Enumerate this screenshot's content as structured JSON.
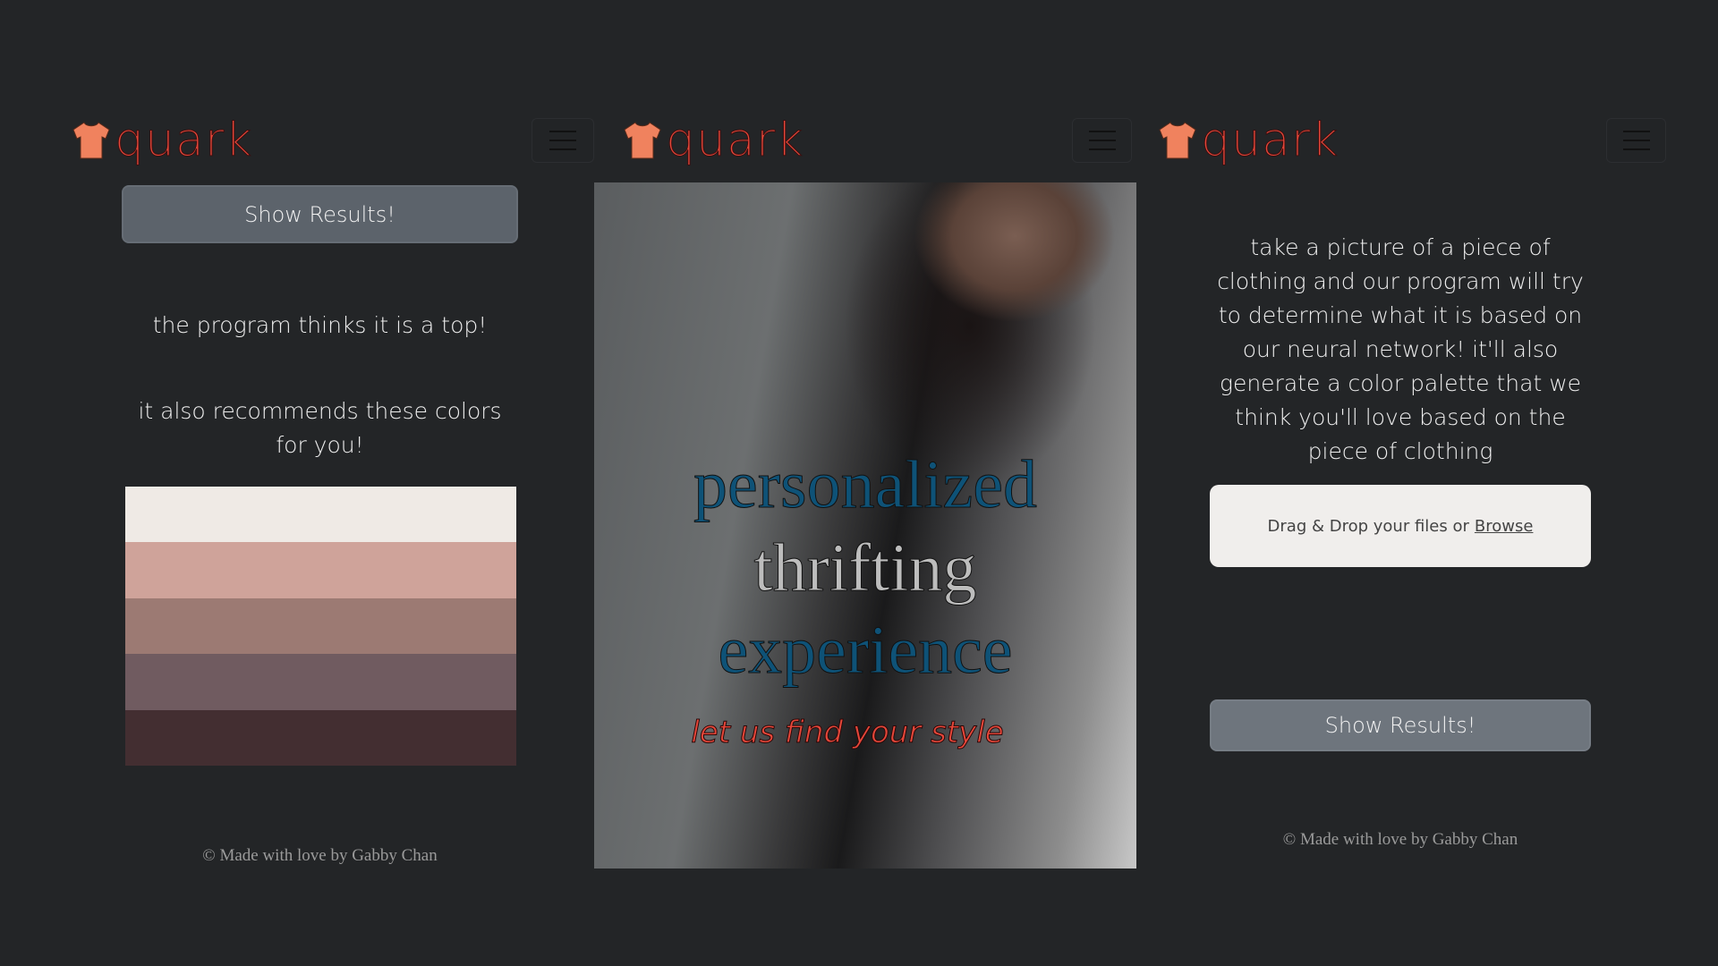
{
  "brand": {
    "name": "quark",
    "logo_color": "#f0825e",
    "text_color": "#e5473a"
  },
  "results_screen": {
    "show_results_label": "Show Results!",
    "prediction_text": "the program thinks it is a top!",
    "recommend_text": "it also recommends these colors for you!",
    "palette": [
      "#efeae5",
      "#cfa39a",
      "#9c7a73",
      "#705b60",
      "#432e31"
    ],
    "footer": "© Made with love by Gabby Chan"
  },
  "landing_screen": {
    "hero_line1": "personalized",
    "hero_line2": "thrifting",
    "hero_line3": "experience",
    "tagline": "let us find your style"
  },
  "upload_screen": {
    "description": "take a picture of a piece of clothing and our program will try to determine what it is based on our neural network! it'll also generate a color palette that we think you'll love based on the piece of clothing",
    "dropzone_text": "Drag & Drop your files or",
    "browse_label": "Browse",
    "show_results_label": "Show Results!",
    "footer": "© Made with love by Gabby Chan"
  }
}
